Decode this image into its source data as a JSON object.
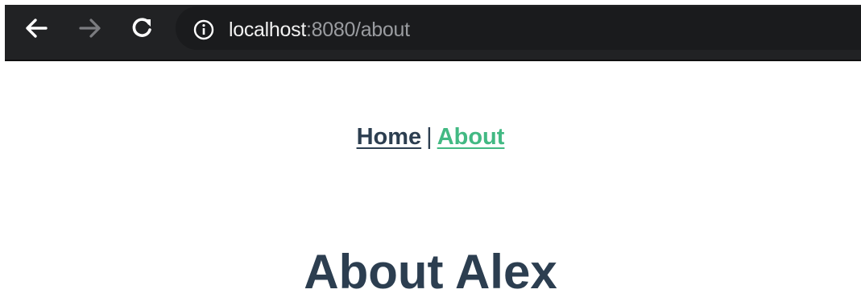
{
  "browser": {
    "url_host": "localhost",
    "url_rest": ":8080/about",
    "icons": {
      "back": "arrow-left-icon",
      "forward": "arrow-right-icon",
      "reload": "reload-icon",
      "info": "info-circle-icon"
    }
  },
  "page": {
    "nav": {
      "home_label": "Home",
      "separator": "|",
      "about_label": "About"
    },
    "title": "About Alex"
  },
  "colors": {
    "toolbar": "#212224",
    "text_dark": "#2c3e50",
    "link_active": "#42b983"
  }
}
